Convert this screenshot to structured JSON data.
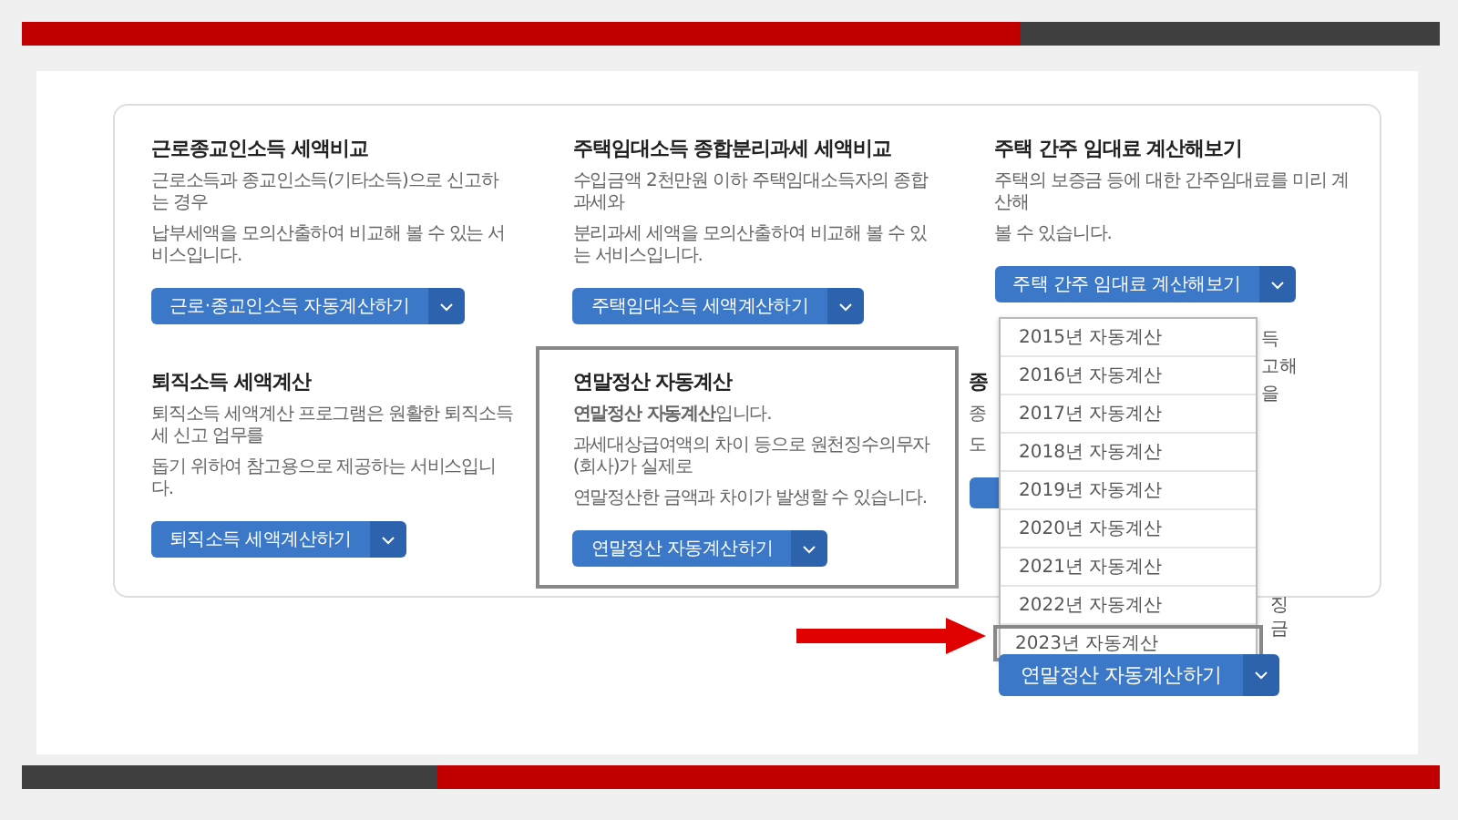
{
  "cards": [
    {
      "kind": "full",
      "title": "근로종교인소득 세액비교",
      "description": [
        "근로소득과 종교인소득(기타소득)으로 신고하는 경우",
        "납부세액을 모의산출하여 비교해 볼 수 있는 서비스입니다."
      ],
      "button": "근로·종교인소득 자동계산하기",
      "highlighted": false
    },
    {
      "kind": "full",
      "title": "주택임대소득 종합분리과세 세액비교",
      "description": [
        "수입금액 2천만원 이하 주택임대소득자의 종합과세와",
        "분리과세 세액을 모의산출하여 비교해 볼 수 있는 서비스입니다."
      ],
      "button": "주택임대소득 세액계산하기",
      "highlighted": false
    },
    {
      "kind": "full",
      "title": "주택 간주 임대료 계산해보기",
      "description": [
        "주택의 보증금 등에 대한 간주임대료를 미리 계산해",
        "볼 수 있습니다."
      ],
      "button": "주택 간주 임대료 계산해보기",
      "highlighted": false
    },
    {
      "kind": "full",
      "title": "퇴직소득 세액계산",
      "description": [
        "퇴직소득 세액계산 프로그램은 원활한 퇴직소득세 신고 업무를",
        "돕기 위하여 참고용으로 제공하는 서비스입니다."
      ],
      "button": "퇴직소득 세액계산하기",
      "highlighted": false
    },
    {
      "kind": "full",
      "title": "연말정산 자동계산",
      "description": [
        "**연말정산 자동계산**입니다.",
        "과세대상급여액의 차이 등으로 원천징수의무자(회사)가 실제로",
        "연말정산한 금액과 차이가 발생할 수 있습니다."
      ],
      "button": "연말정산 자동계산하기",
      "highlighted": true
    },
    {
      "kind": "covered",
      "title": "종",
      "description": [
        "종",
        "도"
      ],
      "highlighted": false
    }
  ],
  "dropdown": {
    "items": [
      {
        "label": "2015년 자동계산",
        "selected": false
      },
      {
        "label": "2016년 자동계산",
        "selected": false
      },
      {
        "label": "2017년 자동계산",
        "selected": false
      },
      {
        "label": "2018년 자동계산",
        "selected": false
      },
      {
        "label": "2019년 자동계산",
        "selected": false
      },
      {
        "label": "2020년 자동계산",
        "selected": false
      },
      {
        "label": "2021년 자동계산",
        "selected": false
      },
      {
        "label": "2022년 자동계산",
        "selected": false
      },
      {
        "label": "2023년 자동계산",
        "selected": true
      }
    ],
    "button": "연말정산 자동계산하기"
  },
  "fragments_upper": [
    "득",
    "고해",
    "을"
  ],
  "fragments_lower": [
    "징",
    "금"
  ]
}
